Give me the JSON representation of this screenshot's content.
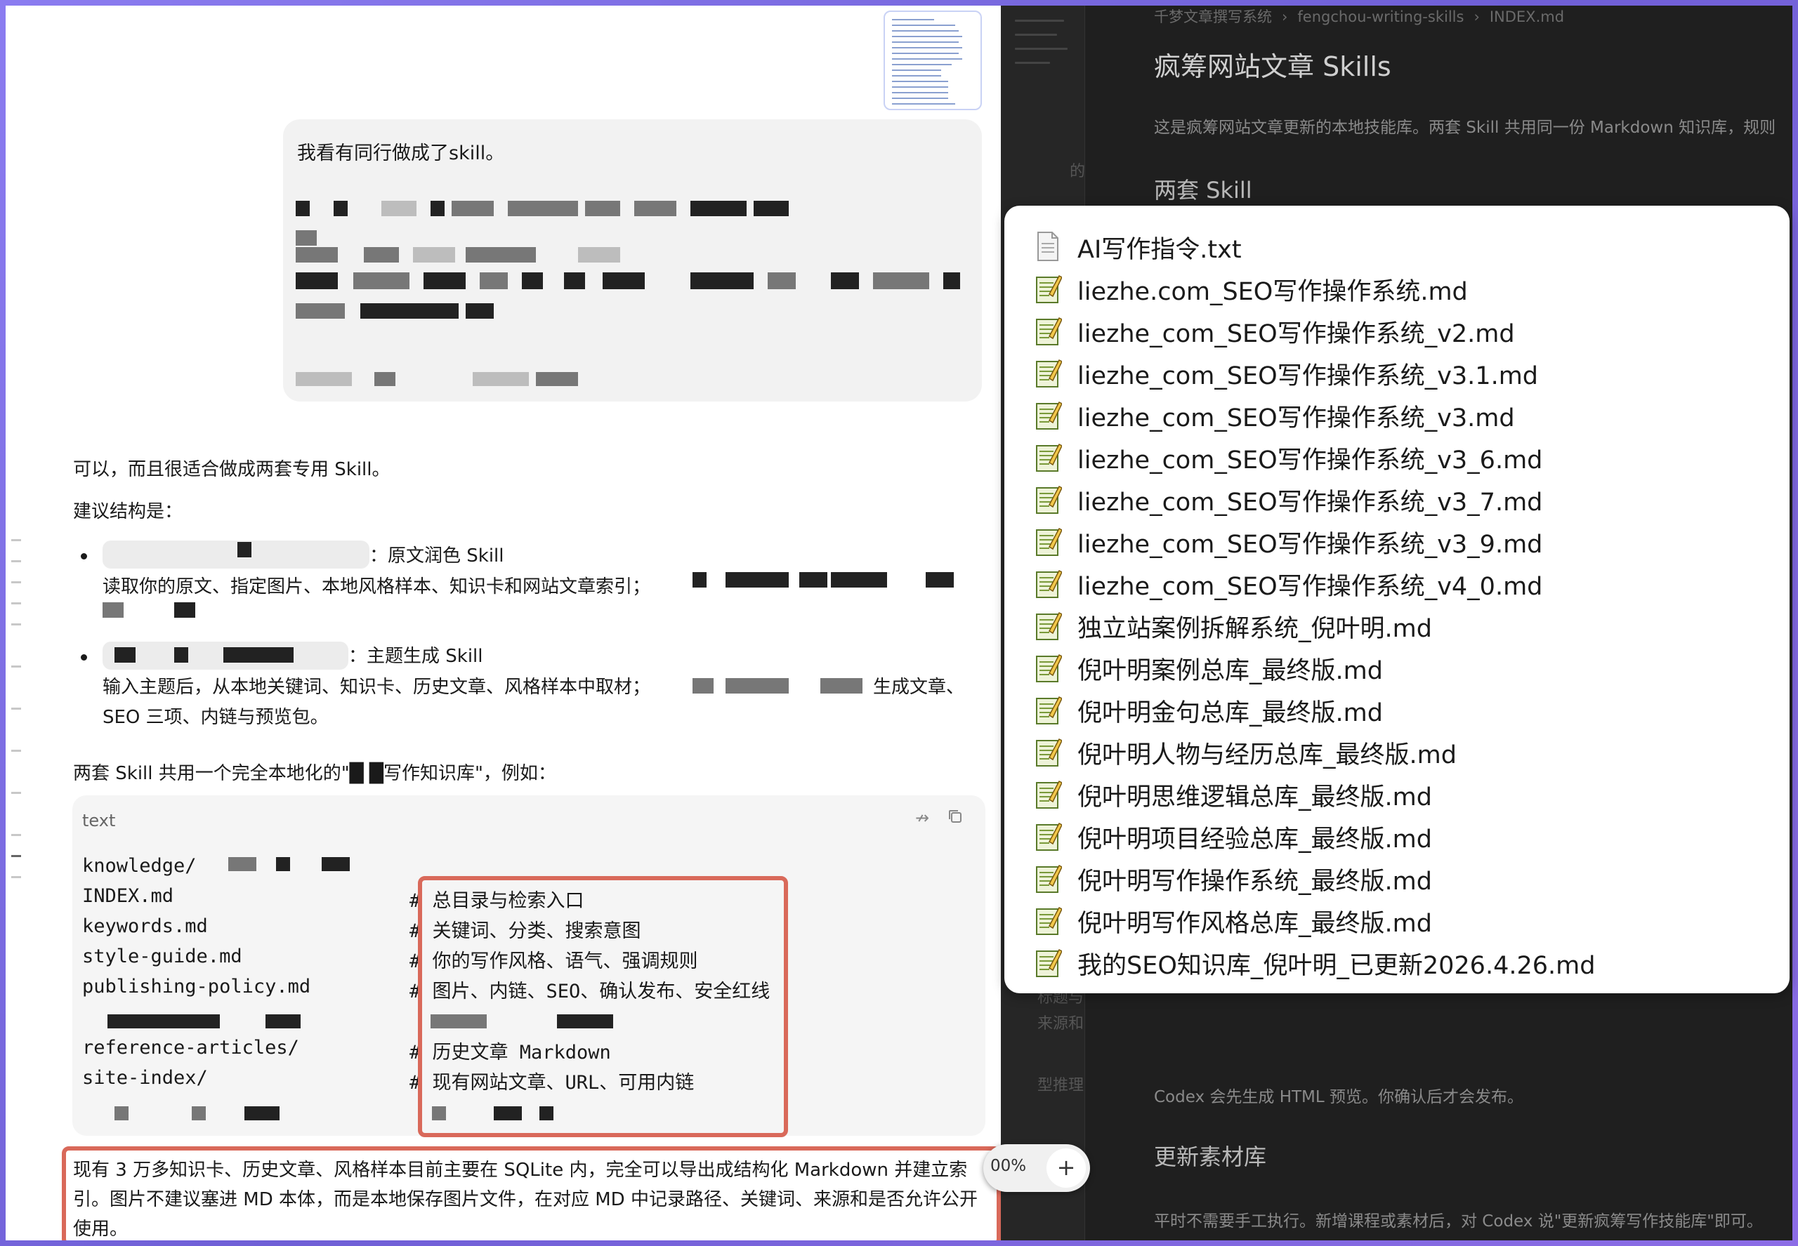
{
  "doc": {
    "breadcrumb": [
      "千梦文章撰写系统",
      "fengchou-writing-skills",
      "INDEX.md"
    ],
    "title": "疯筹网站文章 Skills",
    "intro": "这是疯筹网站文章更新的本地技能库。两套 Skill 共用同一份 Markdown 知识库，规则",
    "h2_skills": "两套 Skill",
    "codex_note": "Codex 会先生成 HTML 预览。你确认后才会发布。",
    "h2_update": "更新素材库",
    "update_text": "平时不需要手工执行。新增课程或素材后，对 Codex 说\"更新疯筹写作技能库\"即可。"
  },
  "sidebar_fragments": [
    "的",
    "标题与",
    "来源和",
    "型推理"
  ],
  "chat": {
    "user_message": "我看有同行做成了skill。",
    "reply_intro": "可以，而且很适合做成两套专用 Skill。",
    "structure_label": "建议结构是：",
    "bullet1_title": "：原文润色 Skill",
    "bullet1_desc": "读取你的原文、指定图片、本地风格样本、知识卡和网站文章索引；",
    "bullet2_title": "：主题生成 Skill",
    "bullet2_desc_a": "输入主题后，从本地关键词、知识卡、历史文章、风格样本中取材；",
    "bullet2_desc_b": "生成文章、",
    "bullet2_desc_c": "SEO 三项、内链与预览包。",
    "shared_kb": "两套 Skill 共用一个完全本地化的\"█  █写作知识库\"，例如："
  },
  "code": {
    "lang": "text",
    "pin_icon": "↛",
    "lines": [
      {
        "path": "knowledge/",
        "comment": ""
      },
      {
        "path": "  INDEX.md",
        "comment": "# 总目录与检索入口"
      },
      {
        "path": "  keywords.md",
        "comment": "# 关键词、分类、搜索意图"
      },
      {
        "path": "  style-guide.md",
        "comment": "# 你的写作风格、语气、强调规则"
      },
      {
        "path": "  publishing-policy.md",
        "comment": "# 图片、内链、SEO、确认发布、安全红线"
      },
      {
        "path": "",
        "comment": ""
      },
      {
        "path": "  reference-articles/",
        "comment": "# 历史文章 Markdown"
      },
      {
        "path": "  site-index/",
        "comment": "# 现有网站文章、URL、可用内链"
      }
    ]
  },
  "bottom_paragraph": "现有 3 万多知识卡、历史文章、风格样本目前主要在 SQLite 内，完全可以导出成结构化 Markdown 并建立索引。图片不建议塞进 MD 本体，而是本地保存图片文件，在对应 MD 中记录路径、关键词、来源和是否允许公开使用。",
  "zoom": {
    "value": "00%",
    "plus": "+"
  },
  "files": [
    {
      "name": "AI写作指令.txt",
      "type": "txt"
    },
    {
      "name": "liezhe.com_SEO写作操作系统.md",
      "type": "md"
    },
    {
      "name": "liezhe_com_SEO写作操作系统_v2.md",
      "type": "md"
    },
    {
      "name": "liezhe_com_SEO写作操作系统_v3.1.md",
      "type": "md"
    },
    {
      "name": "liezhe_com_SEO写作操作系统_v3.md",
      "type": "md"
    },
    {
      "name": "liezhe_com_SEO写作操作系统_v3_6.md",
      "type": "md"
    },
    {
      "name": "liezhe_com_SEO写作操作系统_v3_7.md",
      "type": "md"
    },
    {
      "name": "liezhe_com_SEO写作操作系统_v3_9.md",
      "type": "md"
    },
    {
      "name": "liezhe_com_SEO写作操作系统_v4_0.md",
      "type": "md"
    },
    {
      "name": "独立站案例拆解系统_倪叶明.md",
      "type": "md"
    },
    {
      "name": "倪叶明案例总库_最终版.md",
      "type": "md"
    },
    {
      "name": "倪叶明金句总库_最终版.md",
      "type": "md"
    },
    {
      "name": "倪叶明人物与经历总库_最终版.md",
      "type": "md"
    },
    {
      "name": "倪叶明思维逻辑总库_最终版.md",
      "type": "md"
    },
    {
      "name": "倪叶明项目经验总库_最终版.md",
      "type": "md"
    },
    {
      "name": "倪叶明写作操作系统_最终版.md",
      "type": "md"
    },
    {
      "name": "倪叶明写作风格总库_最终版.md",
      "type": "md"
    },
    {
      "name": "我的SEO知识库_倪叶明_已更新2026.4.26.md",
      "type": "md"
    }
  ],
  "colors": {
    "highlight": "#d9695a",
    "frame": "#7a6ad8",
    "doc_bg": "#1f1f1f"
  }
}
